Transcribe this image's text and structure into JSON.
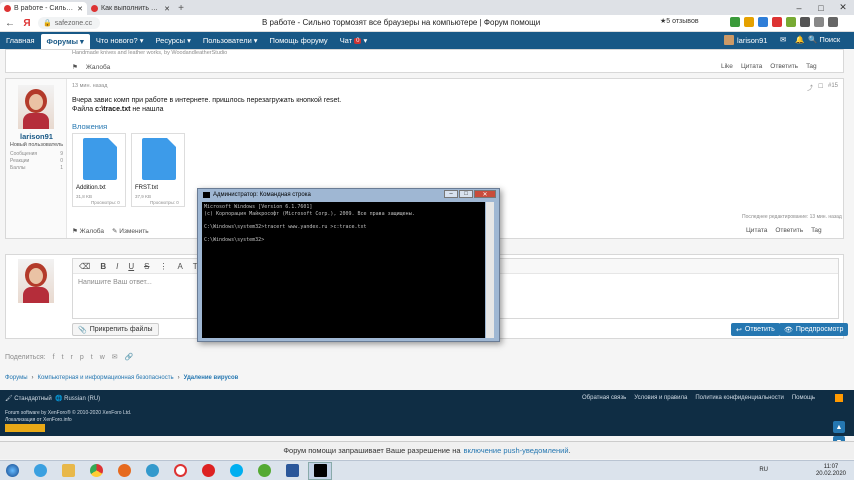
{
  "browser": {
    "tabs": [
      {
        "title": "В работе - Сильно торм",
        "active": true
      },
      {
        "title": "Как выполнить скрипт в",
        "active": false
      }
    ],
    "new_tab": "+",
    "window_controls": [
      "–",
      "□",
      "✕"
    ],
    "url": "safezone.cc",
    "page_title": "В работе - Сильно тормозят все браузеры на компьютере | Форум помощи",
    "reviews": "★5 отзывов",
    "yandex": "Я"
  },
  "forum_nav": {
    "items": [
      "Главная",
      "Форумы",
      "Что нового?",
      "Ресурсы",
      "Пользователи",
      "Помощь форуму",
      "Чат"
    ],
    "active_index": 1,
    "username": "larison91",
    "search": "Поиск"
  },
  "prev_post": {
    "signature": "Handmade knives and leather works, by WoodandleatherStudio",
    "report": "Жалоба",
    "actions": [
      "Like",
      "Цитата",
      "Ответить",
      "Tag"
    ]
  },
  "post": {
    "time": "13 мин. назад",
    "number": "#15",
    "author": "larison91",
    "role": "Новый пользователь",
    "stats": [
      {
        "label": "Сообщения",
        "value": "9"
      },
      {
        "label": "Реакции",
        "value": "0"
      },
      {
        "label": "Баллы",
        "value": "1"
      }
    ],
    "line1": "Вчера завис комп при работе в интернете. пришлось перезагружать кнопкой reset.",
    "line2_prefix": "Файла ",
    "line2_bold": "c:\\trace.txt",
    "line2_suffix": " не нашла",
    "attachments_title": "Вложения",
    "attachments": [
      {
        "name": "Addition.txt",
        "size": "31,8 KB",
        "views": "Просмотры: 0"
      },
      {
        "name": "FRST.txt",
        "size": "37,9 KB",
        "views": "Просмотры: 0"
      }
    ],
    "last_edit": "Последнее редактирование: 13 мин. назад",
    "report": "Жалоба",
    "edit": "Изменить",
    "actions": [
      "Цитата",
      "Ответить",
      "Tag"
    ]
  },
  "cmd": {
    "title": "Администратор: Командная строка",
    "lines": [
      "Microsoft Windows [Version 6.1.7601]",
      "(c) Корпорация Майкрософт (Microsoft Corp.), 2009. Все права защищены.",
      "",
      "C:\\Windows\\system32>tracert www.yandex.ru >c:trace.txt",
      "",
      "C:\\Windows\\system32>"
    ]
  },
  "editor": {
    "tools": [
      "⌫",
      "B",
      "I",
      "U",
      "S",
      "⋮",
      "A",
      "T"
    ],
    "placeholder": "Напишите Ваш ответ...",
    "attach": "Прикрепить файлы",
    "reply": "Ответить",
    "preview": "Предпросмотр"
  },
  "share": {
    "label": "Поделиться:",
    "icons": [
      "f",
      "t",
      "r",
      "p",
      "t",
      "w",
      "✉",
      "🔗"
    ]
  },
  "breadcrumb": [
    "Форумы",
    "Компьютерная и информационная безопасность",
    "Удаление вирусов"
  ],
  "footer": {
    "style": "Стандартный",
    "language": "Russian (RU)",
    "links": [
      "Обратная связь",
      "Условия и правила",
      "Политика конфиденциальности",
      "Помощь"
    ],
    "copyright": "Forum software by XenForo® © 2010-2020 XenForo Ltd.",
    "localization": "Локализация от XenForo.info"
  },
  "push_bar": {
    "prefix": "Форум помощи запрашивает Ваше разрешение на ",
    "link": "включение push-уведомлений",
    "suffix": "."
  },
  "taskbar": {
    "lang": "RU",
    "time": "11:07",
    "date": "20.02.2020"
  },
  "colors": {
    "forum_nav": "#185886",
    "footer": "#0f2d44",
    "accent": "#2577b1",
    "cmd_bg": "#000000"
  }
}
